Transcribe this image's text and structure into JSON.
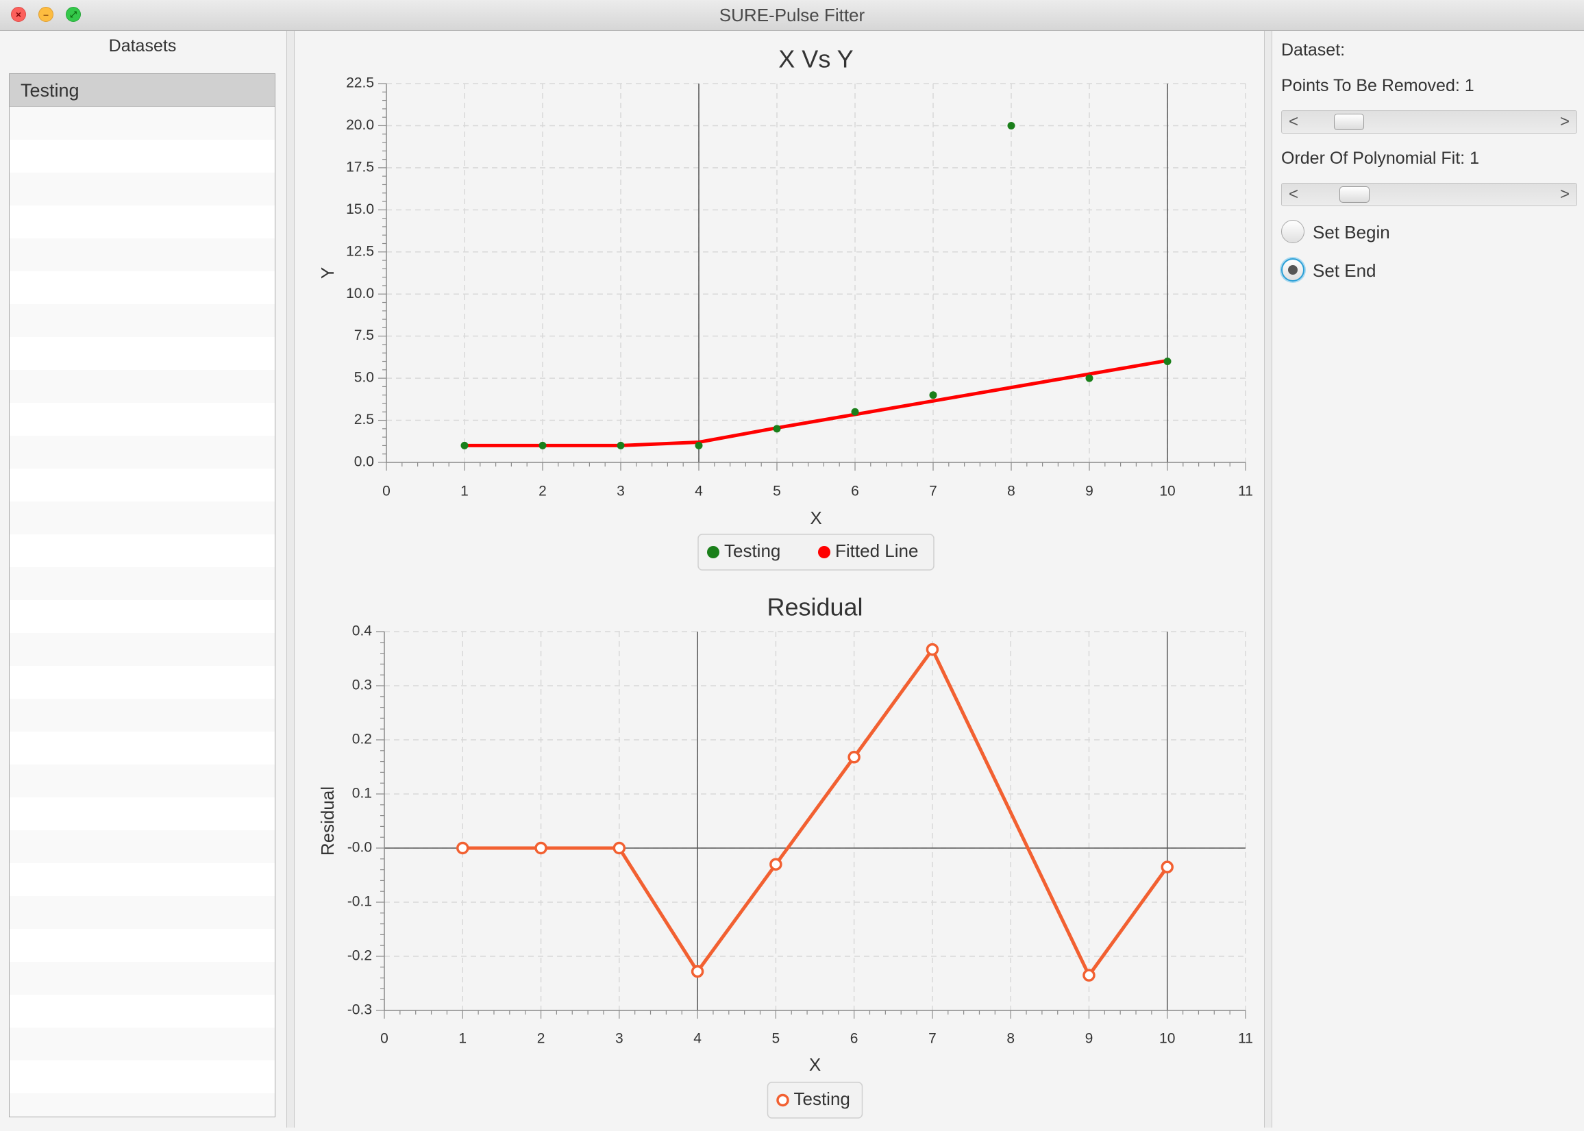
{
  "window": {
    "title": "SURE-Pulse Fitter",
    "close_glyph": "×",
    "minimize_glyph": "–",
    "maximize_glyph": "⤢"
  },
  "sidebar": {
    "title": "Datasets",
    "items": [
      {
        "label": "Testing",
        "selected": true
      }
    ]
  },
  "controls": {
    "dataset_label": "Dataset:",
    "points_removed_label": "Points To Be Removed: 1",
    "points_removed_value": 1,
    "polynomial_order_label": "Order Of Polynomial Fit: 1",
    "polynomial_order_value": 1,
    "scroll_left_glyph": "<",
    "scroll_right_glyph": ">",
    "radios": [
      {
        "label": "Set Begin",
        "checked": false
      },
      {
        "label": "Set End",
        "checked": true
      }
    ]
  },
  "colors": {
    "data_points": "#1a7f1a",
    "fitted_line": "#ff0000",
    "residual": "#f26031"
  },
  "chart_data": [
    {
      "type": "scatter",
      "title": "X Vs Y",
      "xlabel": "X",
      "ylabel": "Y",
      "xlim": [
        0,
        11
      ],
      "ylim": [
        0,
        22.5
      ],
      "x_ticks": [
        0,
        1,
        2,
        3,
        4,
        5,
        6,
        7,
        8,
        9,
        10,
        11
      ],
      "y_ticks": [
        0.0,
        2.5,
        5.0,
        7.5,
        10.0,
        12.5,
        15.0,
        17.5,
        20.0,
        22.5
      ],
      "y_tick_labels": [
        "0.0",
        "2.5",
        "5.0",
        "7.5",
        "10.0",
        "12.5",
        "15.0",
        "17.5",
        "20.0",
        "22.5"
      ],
      "grid": true,
      "vertical_markers": [
        4,
        10
      ],
      "legend_position": "bottom",
      "series": [
        {
          "name": "Testing",
          "kind": "points",
          "x": [
            1,
            2,
            3,
            4,
            5,
            6,
            7,
            8,
            9,
            10
          ],
          "y": [
            1,
            1,
            1,
            1,
            2,
            3,
            4,
            20,
            5,
            6
          ]
        },
        {
          "name": "Fitted Line",
          "kind": "line",
          "x": [
            1,
            2,
            3,
            4,
            5,
            6,
            7,
            8,
            9,
            10
          ],
          "y": [
            1.0,
            1.0,
            1.0,
            1.2,
            2.05,
            2.85,
            3.65,
            4.45,
            5.25,
            6.05
          ]
        }
      ]
    },
    {
      "type": "line",
      "title": "Residual",
      "xlabel": "X",
      "ylabel": "Residual",
      "xlim": [
        0,
        11
      ],
      "ylim": [
        -0.3,
        0.4
      ],
      "x_ticks": [
        0,
        1,
        2,
        3,
        4,
        5,
        6,
        7,
        8,
        9,
        10,
        11
      ],
      "y_ticks": [
        -0.3,
        -0.2,
        -0.1,
        0.0,
        0.1,
        0.2,
        0.3,
        0.4
      ],
      "y_tick_labels": [
        "-0.3",
        "-0.2",
        "-0.1",
        "-0.0",
        "0.1",
        "0.2",
        "0.3",
        "0.4"
      ],
      "grid": true,
      "vertical_markers": [
        4,
        10
      ],
      "zero_line": true,
      "legend_position": "bottom",
      "series": [
        {
          "name": "Testing",
          "x": [
            1,
            2,
            3,
            4,
            5,
            6,
            7,
            9,
            10
          ],
          "y": [
            0.0,
            0.0,
            0.0,
            -0.228,
            -0.03,
            0.168,
            0.367,
            -0.235,
            -0.035
          ]
        }
      ]
    }
  ]
}
